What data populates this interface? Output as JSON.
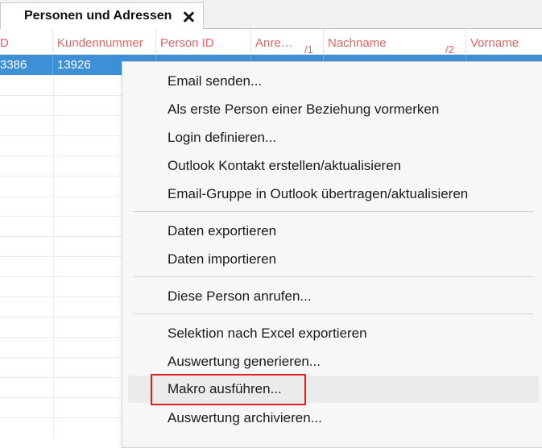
{
  "tab": {
    "title": "Personen und Adressen"
  },
  "grid": {
    "columns": [
      {
        "label": "D",
        "sort": ""
      },
      {
        "label": "Kundennummer",
        "sort": ""
      },
      {
        "label": "Person ID",
        "sort": ""
      },
      {
        "label": "Anre…",
        "sort": "1"
      },
      {
        "label": "Nachname",
        "sort": "2"
      },
      {
        "label": "Vorname",
        "sort": ""
      }
    ],
    "selected_row": [
      "3386",
      "13926",
      "",
      "",
      "",
      ""
    ],
    "header_color": "#e06666",
    "selection_color": "#3d8fd6"
  },
  "menu": {
    "items": [
      "Email senden...",
      "Als erste Person einer Beziehung vormerken",
      "Login definieren...",
      "Outlook Kontakt erstellen/aktualisieren",
      "Email-Gruppe in Outlook übertragen/aktualisieren",
      "Daten exportieren",
      "Daten importieren",
      "Diese Person anrufen...",
      "Selektion nach Excel exportieren",
      "Auswertung generieren...",
      "Makro ausführen...",
      "Auswertung archivieren..."
    ],
    "highlighted_item": "Makro ausführen...",
    "highlight_color": "#e01e1e"
  }
}
